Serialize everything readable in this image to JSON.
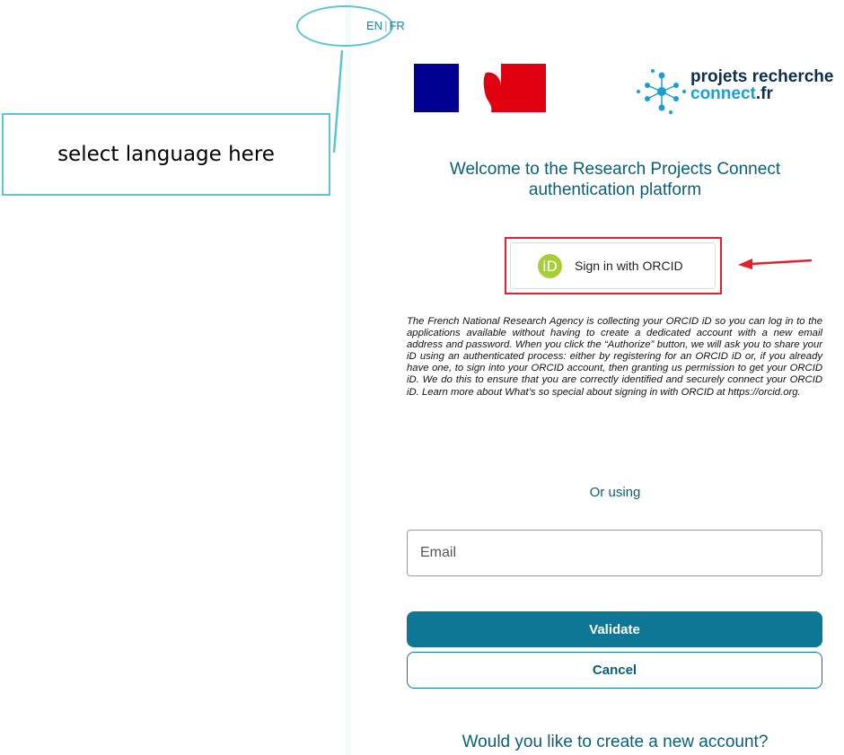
{
  "annotation": {
    "callout_text": "select language here",
    "accent_color": "#5bc4d6",
    "arrow_color": "#e5202a"
  },
  "language": {
    "en": "EN",
    "separator": "|",
    "fr": "FR"
  },
  "logos": {
    "marianne": "french-republic-marianne-logo",
    "brand_line1": "projets recherche",
    "brand_line2": "connect",
    "brand_tld": ".fr"
  },
  "welcome": {
    "line1": "Welcome to the Research Projects Connect",
    "line2": "authentication platform"
  },
  "orcid": {
    "badge": "iD",
    "button_label": "Sign in with ORCID",
    "badge_color": "#a6ce39"
  },
  "disclaimer": "The French National Research Agency is collecting your ORCID iD so you can log in to the applications available without having to create a dedicated account with a new email address and password. When you click the “Authorize” button, we will ask you to share your iD using an authenticated process: either by registering for an ORCID iD or, if you already have one, to sign into your ORCID account, then granting us permission to get your ORCID iD. We do this to ensure that you are correctly identified and securely connect your ORCID iD. Learn more about What’s so special about signing in with ORCID at https://orcid.org.",
  "or_using": "Or using",
  "email": {
    "placeholder": "Email",
    "value": ""
  },
  "buttons": {
    "validate": "Validate",
    "cancel": "Cancel"
  },
  "create_account": "Would you like to create a new account?",
  "colors": {
    "primary": "#0d7795",
    "heading": "#0a5f78"
  }
}
